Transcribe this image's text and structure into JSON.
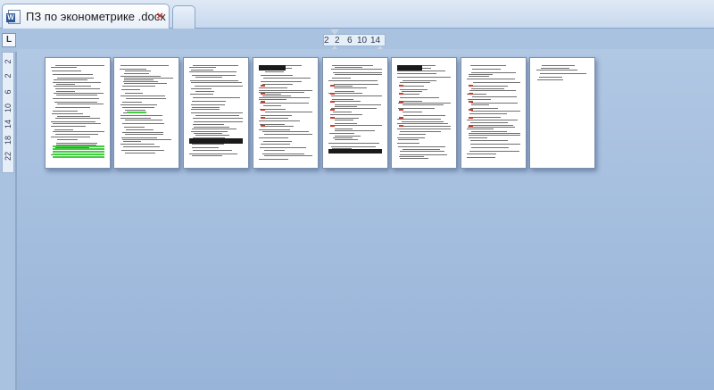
{
  "tab": {
    "title": "ПЗ по эконометрике .docx",
    "close": "×"
  },
  "ruler": {
    "corner": "L",
    "h_ticks": [
      "2",
      "2",
      "6",
      "10",
      "14"
    ],
    "v_ticks": [
      "2",
      "2",
      "6",
      "10",
      "14",
      "18",
      "22"
    ]
  },
  "pages": [
    {
      "name": "page-1"
    },
    {
      "name": "page-2"
    },
    {
      "name": "page-3"
    },
    {
      "name": "page-4"
    },
    {
      "name": "page-5"
    },
    {
      "name": "page-6"
    },
    {
      "name": "page-7"
    },
    {
      "name": "page-8"
    }
  ],
  "colors": {
    "workspace": "#a9c2e0",
    "highlight_green": "#3fcf3f",
    "highlight_red": "#d23a2a"
  }
}
